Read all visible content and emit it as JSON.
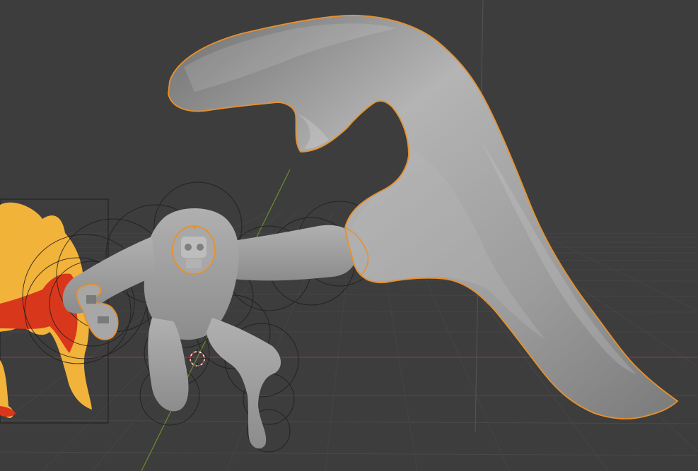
{
  "viewport": {
    "background_color": "#3d3d3d",
    "grid_color": "#4a4a4a",
    "x_axis_color": "#8a3a3e",
    "y_axis_color": "#6b8e2a",
    "selection_outline_color": "#e8902a",
    "mesh_color": "#9a9a9a"
  },
  "objects": [
    {
      "kind": "mesh",
      "name": "hook-shaped-sculpt",
      "selected": true
    },
    {
      "kind": "metaball",
      "name": "creature-body",
      "selected": false
    },
    {
      "kind": "mesh",
      "name": "skull-head",
      "selected": true
    },
    {
      "kind": "mesh",
      "name": "hand-link",
      "selected": true
    },
    {
      "kind": "mesh",
      "name": "fire-effect",
      "selected": false
    },
    {
      "kind": "cursor",
      "name": "3d-cursor"
    }
  ]
}
